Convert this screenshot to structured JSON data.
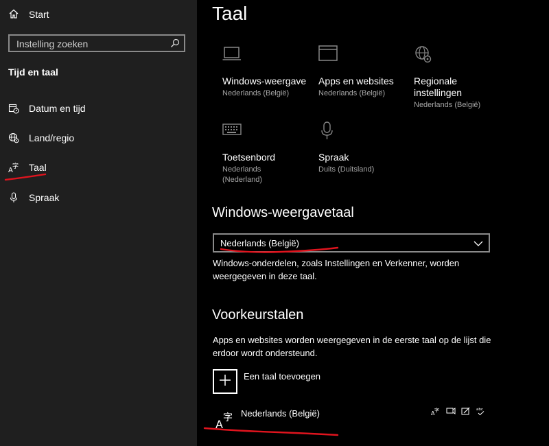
{
  "sidebar": {
    "home_label": "Start",
    "search_placeholder": "Instelling zoeken",
    "category": "Tijd en taal",
    "items": [
      {
        "label": "Datum en tijd",
        "icon": "calendar-clock-icon"
      },
      {
        "label": "Land/regio",
        "icon": "globe-gear-icon"
      },
      {
        "label": "Taal",
        "icon": "language-icon",
        "selected": true
      },
      {
        "label": "Spraak",
        "icon": "microphone-icon"
      }
    ]
  },
  "main": {
    "title": "Taal",
    "tiles": [
      {
        "label": "Windows-weergave",
        "sub": "Nederlands (België)",
        "icon": "monitor-icon"
      },
      {
        "label": "Apps en websites",
        "sub": "Nederlands (België)",
        "icon": "window-icon"
      },
      {
        "label": "Regionale instellingen",
        "sub": "Nederlands (België)",
        "icon": "globe-gear-icon"
      },
      {
        "label": "Toetsenbord",
        "sub": "Nederlands (Nederland)",
        "icon": "keyboard-icon"
      },
      {
        "label": "Spraak",
        "sub": "Duits (Duitsland)",
        "icon": "microphone-icon"
      }
    ],
    "display_language": {
      "title": "Windows-weergavetaal",
      "selected": "Nederlands (België)",
      "description": "Windows-onderdelen, zoals Instellingen en Verkenner, worden weergegeven in deze taal."
    },
    "preferred": {
      "title": "Voorkeurstalen",
      "description": "Apps en websites worden weergegeven in de eerste taal op de lijst die erdoor wordt ondersteund.",
      "add_label": "Een taal toevoegen",
      "languages": [
        {
          "name": "Nederlands (België)",
          "features": [
            "display-language-icon",
            "speech-icon",
            "handwriting-icon",
            "spellcheck-icon"
          ]
        }
      ]
    }
  },
  "colors": {
    "sidebar_bg": "#1f1f1f",
    "main_bg": "#000000",
    "annotation": "#e0141e",
    "secondary_text": "#a6a6a6"
  }
}
